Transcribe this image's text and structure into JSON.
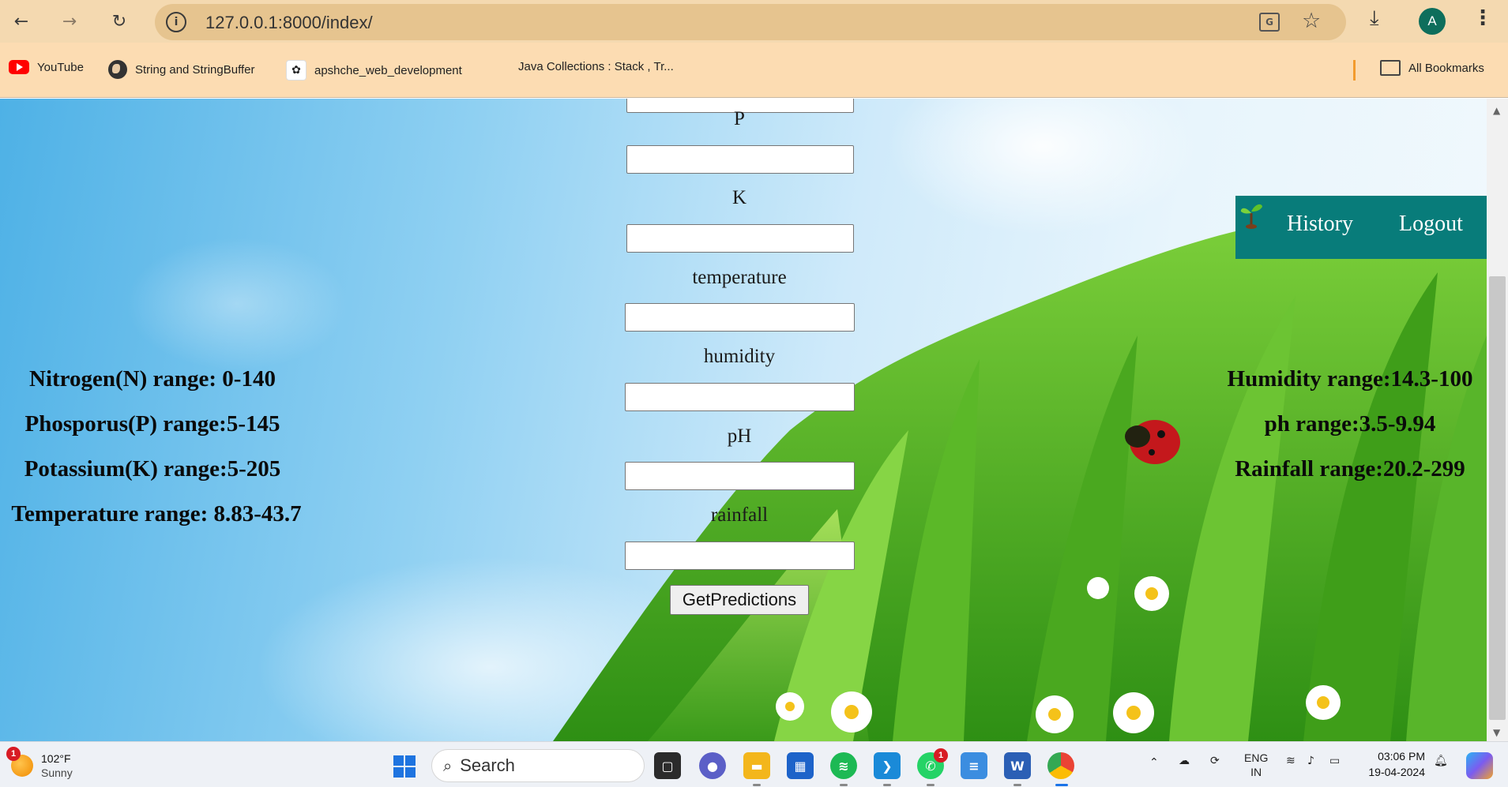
{
  "browser": {
    "url": "127.0.0.1:8000/index/",
    "profile_initial": "A",
    "bookmarks": [
      {
        "label": "YouTube",
        "icon": "youtube-icon"
      },
      {
        "label": "String and StringBuffer",
        "icon": "globe-icon"
      },
      {
        "label": "apshche_web_development",
        "icon": "github-icon"
      },
      {
        "label": "Java Collections : Stack , Tr...",
        "icon": "none"
      }
    ],
    "all_bookmarks": "All Bookmarks"
  },
  "nav": {
    "history": "History",
    "logout": "Logout",
    "logo_icon": "sprout-icon"
  },
  "form": {
    "fields": [
      {
        "label": "P",
        "value": ""
      },
      {
        "label": "K",
        "value": ""
      },
      {
        "label": "temperature",
        "value": ""
      },
      {
        "label": "humidity",
        "value": ""
      },
      {
        "label": "pH",
        "value": ""
      },
      {
        "label": "rainfall",
        "value": ""
      }
    ],
    "submit": "GetPredictions"
  },
  "ranges_left": [
    "Nitrogen(N) range: 0-140",
    "Phosporus(P) range:5-145",
    "Potassium(K) range:5-205",
    "Temperature range: 8.83-43.7"
  ],
  "ranges_right": [
    "Humidity range:14.3-100",
    "ph range:3.5-9.94",
    "Rainfall range:20.2-299"
  ],
  "taskbar": {
    "weather_temp": "102°F",
    "weather_desc": "Sunny",
    "weather_badge": "1",
    "search_placeholder": "Search",
    "whatsapp_badge": "1",
    "lang_top": "ENG",
    "lang_bottom": "IN",
    "time": "03:06 PM",
    "date": "19-04-2024"
  }
}
